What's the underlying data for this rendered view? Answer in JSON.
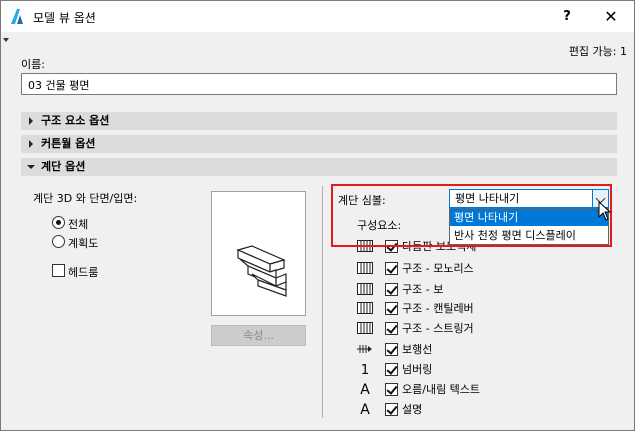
{
  "window": {
    "title": "모델 뷰 옵션",
    "help_label": "?",
    "close_label": "✕"
  },
  "edit_status": "편집 가능: 1",
  "name_field": {
    "label": "이름:",
    "value": "03 건물 평면"
  },
  "sections": {
    "structure": "구조 요소 옵션",
    "curtain_wall": "커튼월 옵션",
    "stair": "계단 옵션"
  },
  "left_panel": {
    "heading": "계단 3D 와 단면/입면:",
    "radio_full": "전체",
    "radio_schematic": "계획도",
    "headroom_label": "헤드룸",
    "attributes_button": "속성..."
  },
  "symbol": {
    "label": "계단 심볼:",
    "selected": "평면 나타내기",
    "options": [
      "평면 나타내기",
      "반사 천정 평면 디스플레이"
    ]
  },
  "components_label": "구성요소:",
  "components": [
    {
      "icon": "hatch-icon",
      "label": "다듬판 보도덕체",
      "checked": true
    },
    {
      "icon": "hatch-icon",
      "label": "구조 - 모노리스",
      "checked": true
    },
    {
      "icon": "hatch-icon",
      "label": "구조 - 보",
      "checked": true
    },
    {
      "icon": "hatch-icon",
      "label": "구조 - 캔틸레버",
      "checked": true
    },
    {
      "icon": "hatch-icon",
      "label": "구조 - 스트링거",
      "checked": true
    },
    {
      "icon": "walking-line-icon",
      "label": "보행선",
      "checked": true
    },
    {
      "icon": "numbering-icon",
      "label": "넘버링",
      "checked": true
    },
    {
      "icon": "text-icon",
      "label": "오름/내림 텍스트",
      "checked": true
    },
    {
      "icon": "text-icon",
      "label": "설명",
      "checked": true
    }
  ],
  "colors": {
    "highlight": "#e01b1b",
    "selection": "#0078d7",
    "section_bg": "#dcdcdc"
  }
}
